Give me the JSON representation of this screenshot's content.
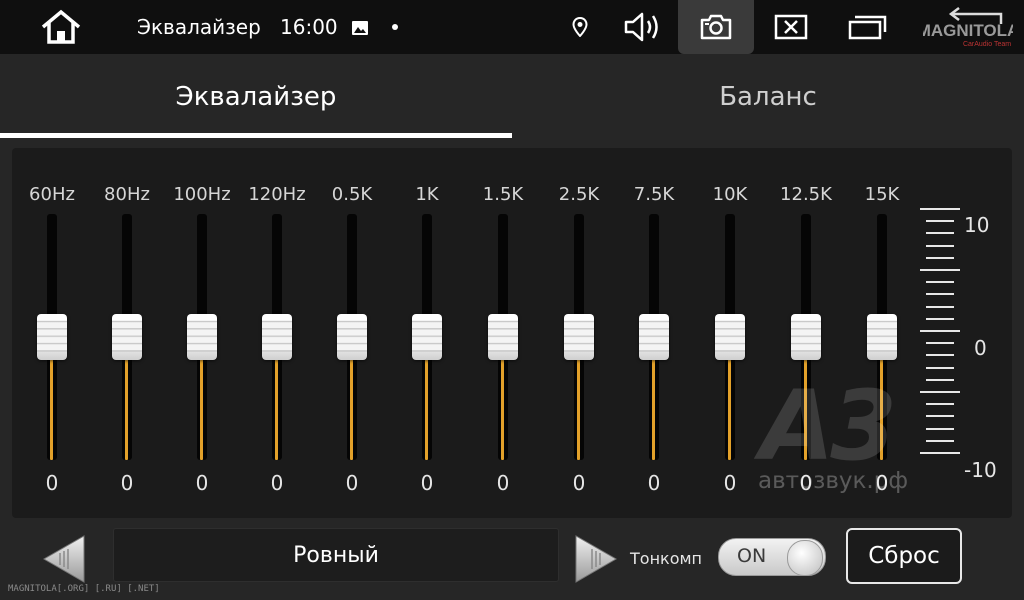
{
  "status_bar": {
    "title": "Эквалайзер",
    "time": "16:00",
    "brand_logo_text": "MAGNITOLA",
    "brand_logo_subtext": "CarAudio Team",
    "icons": [
      "home-icon",
      "image-icon",
      "dot-indicator",
      "location-icon",
      "volume-icon",
      "camera-icon",
      "close-box-icon",
      "windows-icon",
      "back-icon"
    ]
  },
  "tabs": [
    {
      "label": "Эквалайзер",
      "active": true
    },
    {
      "label": "Баланс",
      "active": false
    }
  ],
  "bands": [
    {
      "label": "60Hz",
      "value": "0"
    },
    {
      "label": "80Hz",
      "value": "0"
    },
    {
      "label": "100Hz",
      "value": "0"
    },
    {
      "label": "120Hz",
      "value": "0"
    },
    {
      "label": "0.5K",
      "value": "0"
    },
    {
      "label": "1K",
      "value": "0"
    },
    {
      "label": "1.5K",
      "value": "0"
    },
    {
      "label": "2.5K",
      "value": "0"
    },
    {
      "label": "7.5K",
      "value": "0"
    },
    {
      "label": "10K",
      "value": "0"
    },
    {
      "label": "12.5K",
      "value": "0"
    },
    {
      "label": "15K",
      "value": "0"
    }
  ],
  "scale": {
    "max": "10",
    "mid": "0",
    "min": "-10"
  },
  "watermark": {
    "logo": "A3",
    "site": "автозвук.рф"
  },
  "preset": {
    "label": "Ровный"
  },
  "tonkomp": {
    "label": "Тонкомп",
    "state": "ON"
  },
  "reset_label": "Сброс",
  "footer_watermark": "MAGNITOLA[.ORG] [.RU] [.NET]",
  "colors": {
    "accent": "#e3a12a",
    "background": "#262626",
    "panel": "#1b1b1b",
    "status_bar": "#0f0f0f"
  }
}
